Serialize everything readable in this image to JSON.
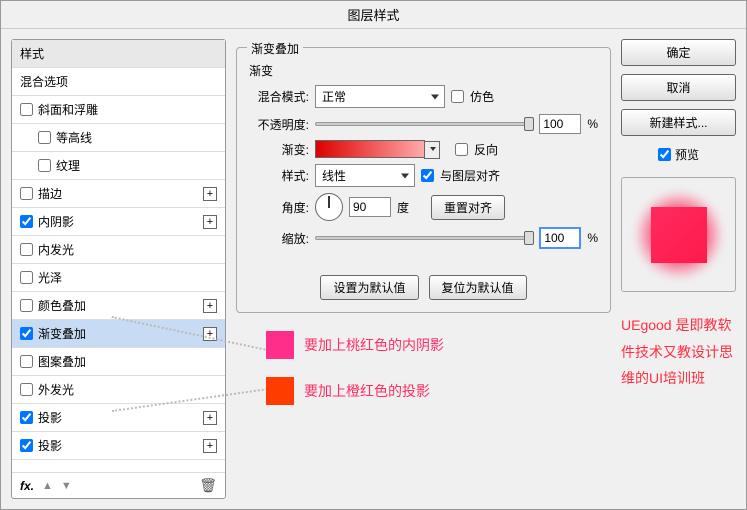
{
  "title": "图层样式",
  "left": {
    "header": "样式",
    "blend_options": "混合选项",
    "bevel": "斜面和浮雕",
    "contour": "等高线",
    "texture": "纹理",
    "stroke": "描边",
    "inner_shadow": "内阴影",
    "inner_glow": "内发光",
    "satin": "光泽",
    "color_overlay": "颜色叠加",
    "gradient_overlay": "渐变叠加",
    "pattern_overlay": "图案叠加",
    "outer_glow": "外发光",
    "drop_shadow": "投影",
    "drop_shadow2": "投影"
  },
  "center": {
    "group": "渐变叠加",
    "sub": "渐变",
    "blend_mode_lbl": "混合模式:",
    "blend_mode_val": "正常",
    "dither": "仿色",
    "opacity_lbl": "不透明度:",
    "opacity_val": "100",
    "pct": "%",
    "gradient_lbl": "渐变:",
    "reverse": "反向",
    "style_lbl": "样式:",
    "style_val": "线性",
    "align": "与图层对齐",
    "angle_lbl": "角度:",
    "angle_val": "90",
    "deg": "度",
    "reset_align": "重置对齐",
    "scale_lbl": "缩放:",
    "scale_val": "100",
    "set_default": "设置为默认值",
    "reset_default": "复位为默认值",
    "note1": "要加上桃红色的内阴影",
    "note2": "要加上橙红色的投影"
  },
  "right": {
    "ok": "确定",
    "cancel": "取消",
    "new_style": "新建样式...",
    "preview": "预览",
    "desc": "UEgood 是即教软件技术又教设计思维的UI培训班"
  }
}
